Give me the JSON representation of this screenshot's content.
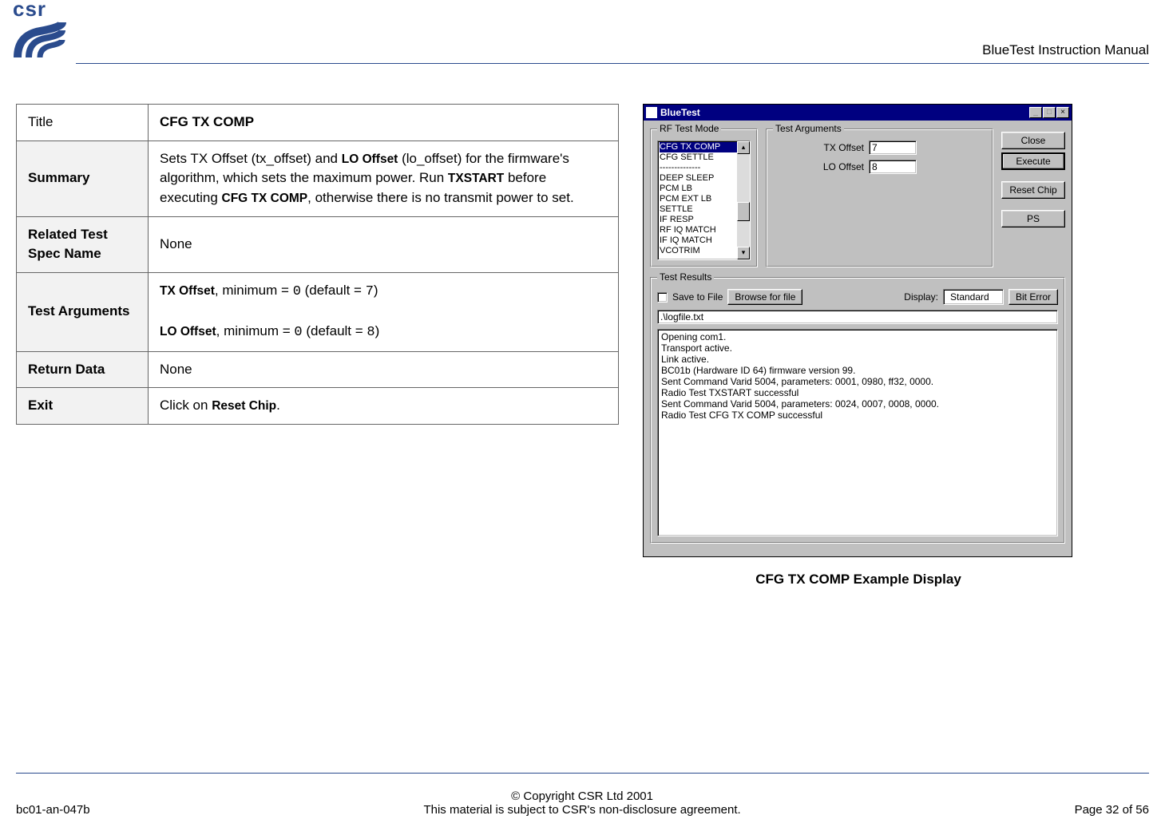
{
  "header": {
    "doc_title": "BlueTest Instruction Manual"
  },
  "spec_table": {
    "title_label": "Title",
    "title_value": "CFG TX COMP",
    "summary_label": "Summary",
    "summary_html": "Sets TX Offset (tx_offset) and <b class='sans-small'>LO Offset</b> (lo_offset) for the firmware's algorithm, which sets the maximum power. Run <b class='sans-small'>TXSTART</b> before executing <b class='sans-small'>CFG TX COMP</b>, otherwise there is no transmit power to set.",
    "related_label": "Related Test Spec Name",
    "related_value": "None",
    "testargs_label": "Test Arguments",
    "testargs_html": "<b class='sans-small'>TX Offset</b>, minimum = <span class='mono'>0</span> (default = <span class='mono'>7</span>)<br><br><b class='sans-small'>LO Offset</b>, minimum = <span class='mono'>0</span> (default = <span class='mono'>8</span>)",
    "return_label": "Return Data",
    "return_value": "None",
    "exit_label": "Exit",
    "exit_html": "Click on <b class='sans-small'>Reset Chip</b>."
  },
  "screenshot": {
    "window_title": "BlueTest",
    "groups": {
      "rf_mode": "RF Test Mode",
      "test_args": "Test Arguments",
      "test_results": "Test Results"
    },
    "rf_list": [
      "CFG TX COMP",
      "CFG SETTLE",
      "--------------",
      "DEEP SLEEP",
      "PCM LB",
      "PCM EXT LB",
      "SETTLE",
      "IF RESP",
      "RF IQ MATCH",
      "IF IQ MATCH",
      "VCOTRIM"
    ],
    "arg1_label": "TX Offset",
    "arg1_value": "7",
    "arg2_label": "LO Offset",
    "arg2_value": "8",
    "buttons": {
      "close": "Close",
      "execute": "Execute",
      "reset": "Reset Chip",
      "ps": "PS"
    },
    "save_to_file": "Save to File",
    "browse": "Browse for file",
    "display_label": "Display:",
    "display_value": "Standard",
    "bit_error": "Bit Error",
    "logfile": ".\\logfile.txt",
    "output": "Opening com1.\nTransport active.\nLink active.\nBC01b (Hardware ID 64) firmware version 99.\nSent Command Varid 5004, parameters: 0001, 0980, ff32, 0000.\nRadio Test TXSTART successful\nSent Command Varid 5004, parameters: 0024, 0007, 0008, 0000.\nRadio Test CFG TX COMP successful",
    "caption": "CFG TX COMP Example Display"
  },
  "footer": {
    "doc_code": "bc01-an-047b",
    "copyright": "© Copyright CSR Ltd 2001",
    "nda": "This material is subject to CSR's non-disclosure agreement.",
    "page": "Page 32 of 56"
  }
}
